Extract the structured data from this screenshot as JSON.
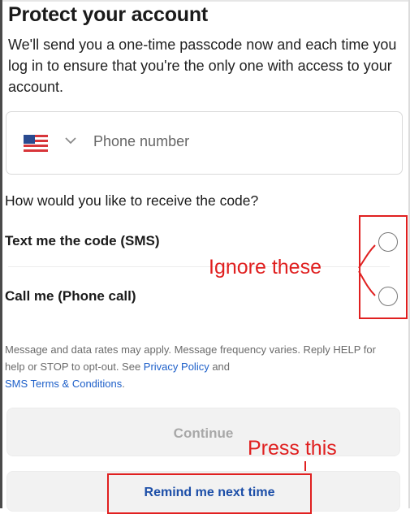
{
  "header": {
    "title": "Protect your account",
    "description": "We'll send you a one-time passcode now and each time you log in to ensure that you're the only one with access to your account."
  },
  "phone": {
    "country_icon": "us-flag-icon",
    "placeholder": "Phone number"
  },
  "delivery": {
    "question": "How would you like to receive the code?",
    "options": [
      {
        "label": "Text me the code (SMS)",
        "selected": false
      },
      {
        "label": "Call me (Phone call)",
        "selected": false
      }
    ]
  },
  "disclaimer": {
    "text_before": "Message and data rates may apply. Message frequency varies. Reply HELP for help or STOP to opt-out. See ",
    "privacy_link": "Privacy Policy",
    "text_and": " and ",
    "sms_terms_link": "SMS Terms & Conditions",
    "text_end": "."
  },
  "actions": {
    "continue_label": "Continue",
    "remind_label": "Remind me next time"
  },
  "annotations": {
    "ignore_text": "Ignore  these",
    "press_text": "Press this",
    "color": "#e02020"
  },
  "colors": {
    "link": "#1d5fc9",
    "disabled_text": "#a8a8a8"
  }
}
